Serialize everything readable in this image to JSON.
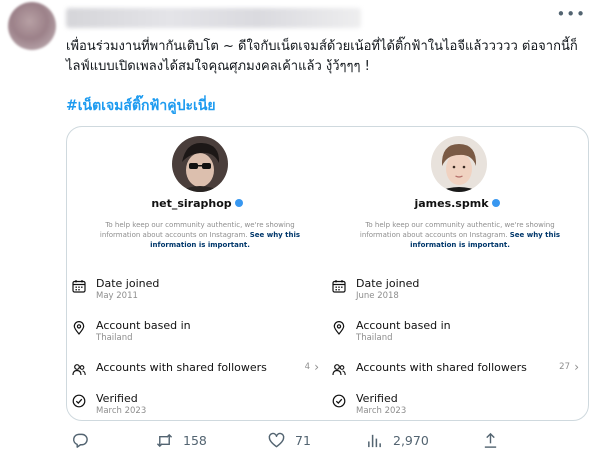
{
  "tweet": {
    "text": "เพื่อนร่วมงานที่พากันเติบโต ~ ดีใจกับเน็ตเจมส์ด้วยเน้อที่ได้ติ๊กฟ้าในไอจีแล้ววววว ต่อจากนี้ก็ไลฟ์แบบเปิดเพลงได้สมใจคุณศุภมงคลเค้าแล้ว งุ้ว้ๆๆๆ !",
    "hashtag": "#เน็ตเจมส์ติ๊กฟ้าคู่ปะเนี่ย",
    "more_icon": "more-horizontal-icon"
  },
  "accounts": [
    {
      "handle": "net_siraphop",
      "notice": "To help keep our community authentic, we're showing information about accounts on Instagram.",
      "notice_link": "See why this information is important.",
      "date_joined_label": "Date joined",
      "date_joined": "May 2011",
      "based_in_label": "Account based in",
      "based_in": "Thailand",
      "shared_label": "Accounts with shared followers",
      "shared_count": "4",
      "verified_label": "Verified",
      "verified_date": "March 2023"
    },
    {
      "handle": "james.spmk",
      "notice": "To help keep our community authentic, we're showing information about accounts on Instagram.",
      "notice_link": "See why this information is important.",
      "date_joined_label": "Date joined",
      "date_joined": "June 2018",
      "based_in_label": "Account based in",
      "based_in": "Thailand",
      "shared_label": "Accounts with shared followers",
      "shared_count": "27",
      "verified_label": "Verified",
      "verified_date": "March 2023"
    }
  ],
  "actions": {
    "reply_count": "",
    "retweet_count": "158",
    "like_count": "71",
    "views_count": "2,970"
  },
  "colors": {
    "accent": "#1d9bf0",
    "ig_verified": "#3897f0",
    "muted": "#536471"
  }
}
